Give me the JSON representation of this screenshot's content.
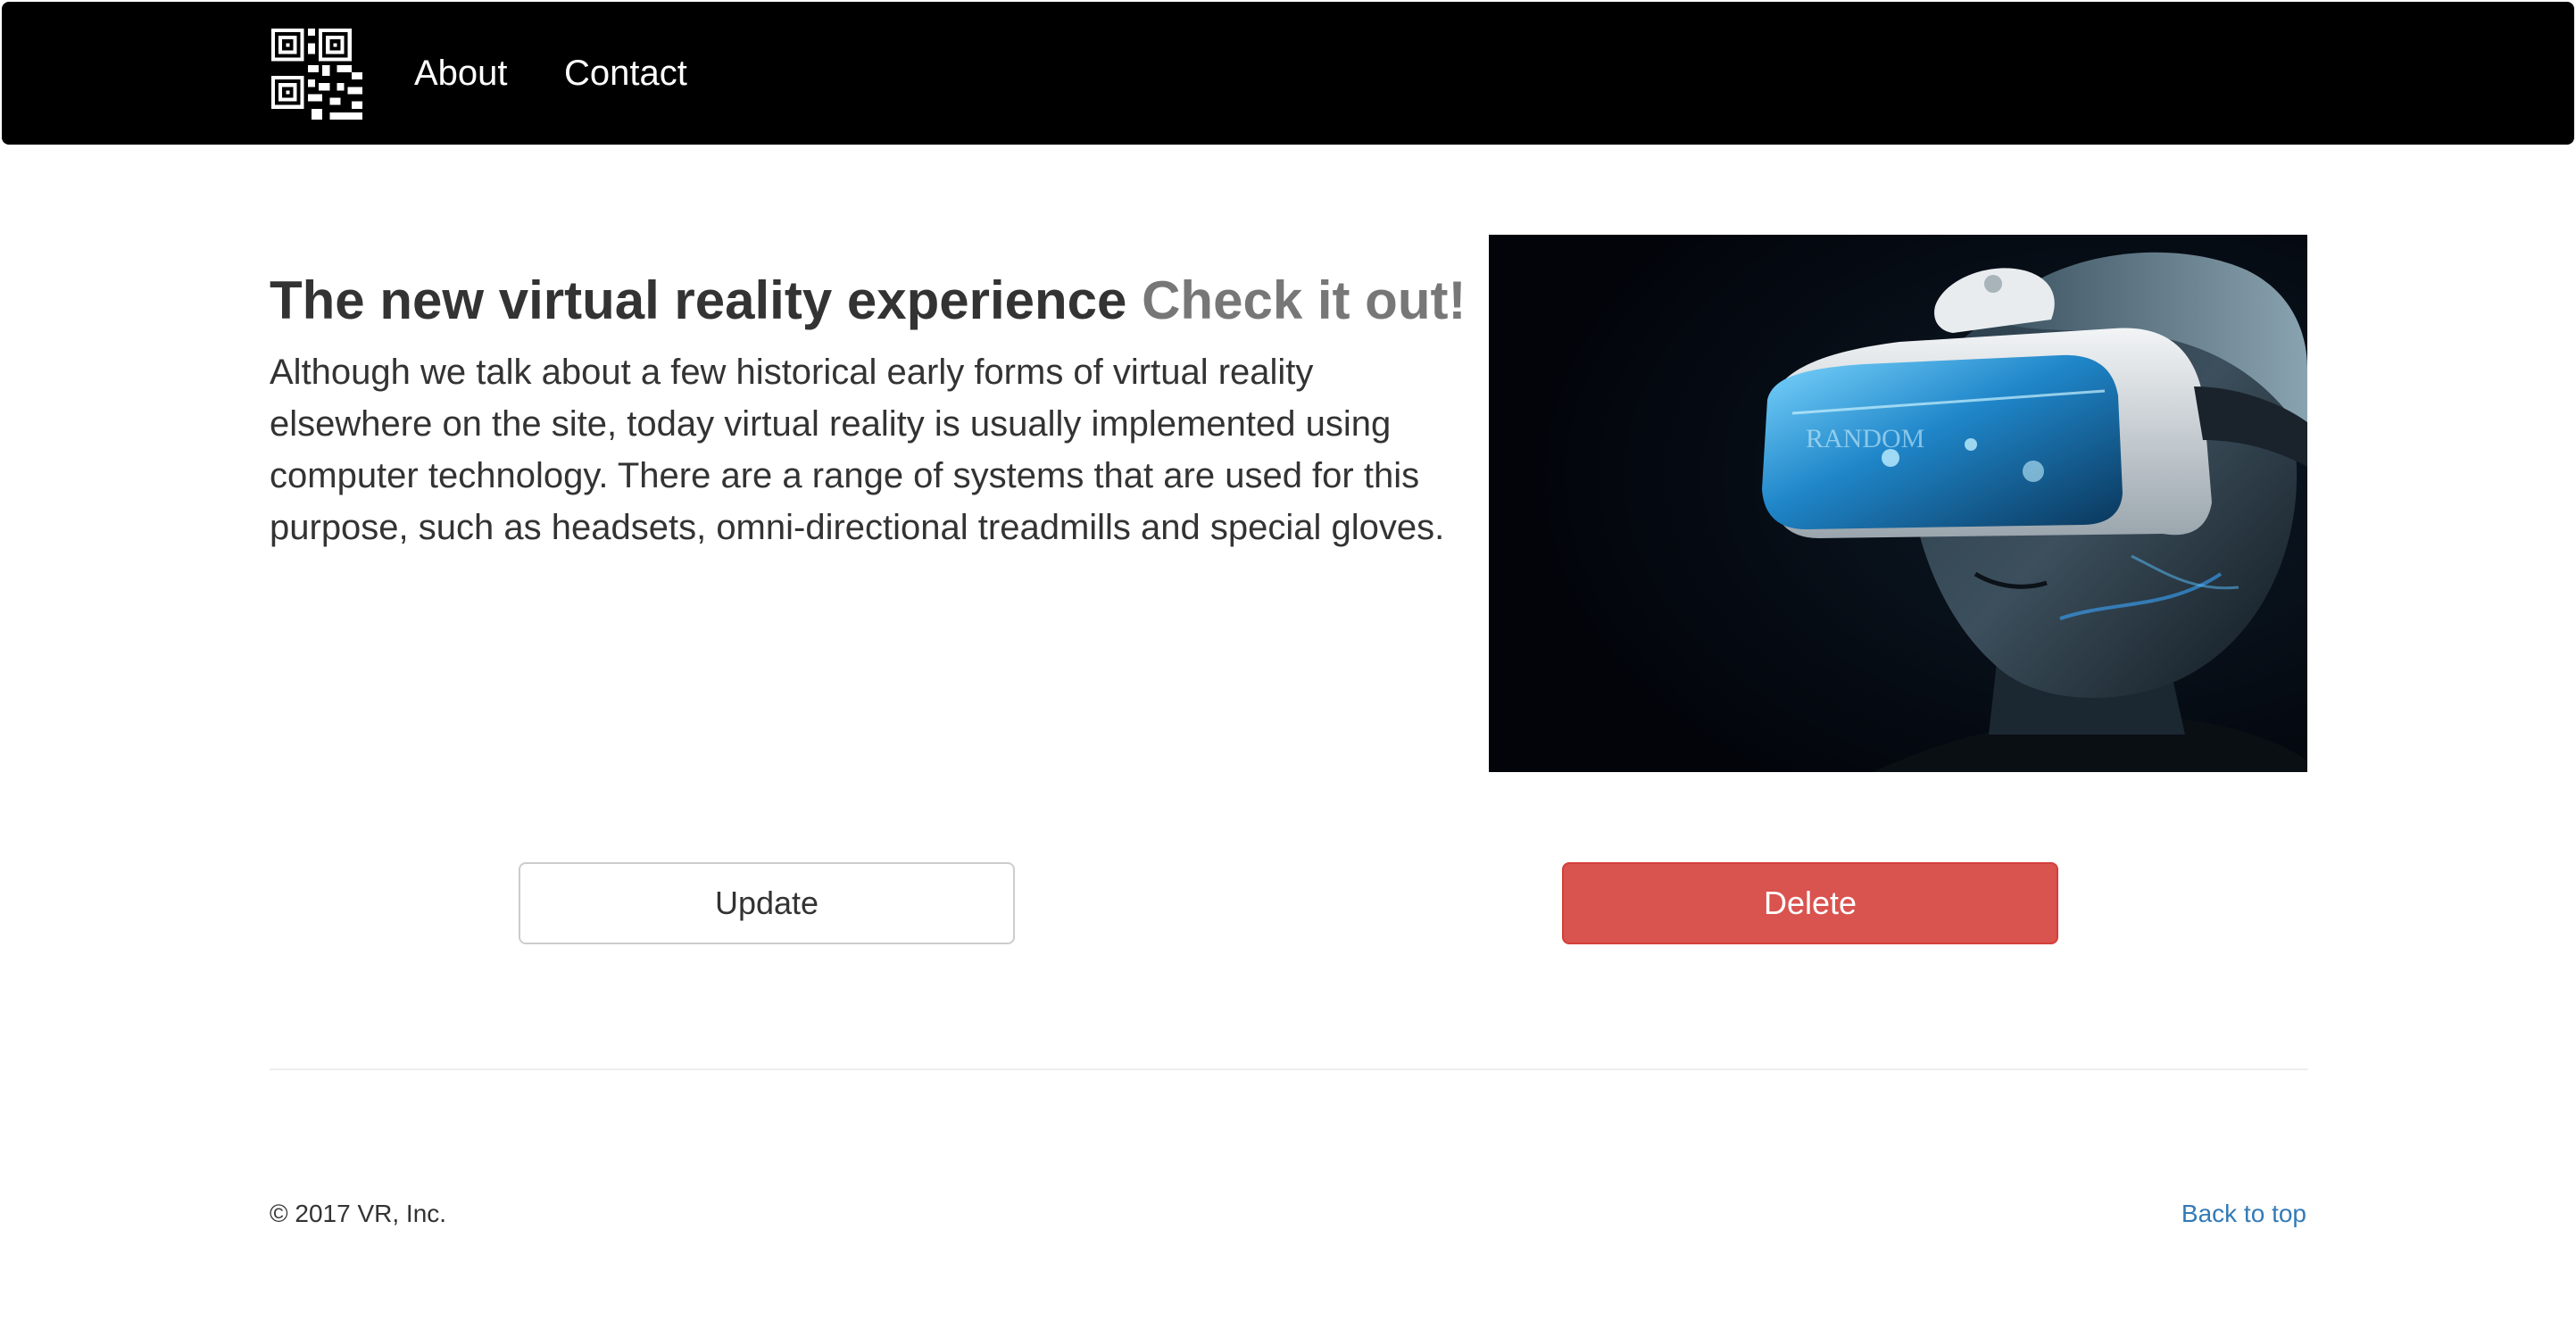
{
  "navbar": {
    "logo_icon": "qr-code-icon",
    "links": [
      {
        "label": "About"
      },
      {
        "label": "Contact"
      }
    ]
  },
  "hero": {
    "heading_main": "The new virtual reality experience",
    "heading_muted": "Check it out!",
    "paragraph": "Although we talk about a few historical early forms of virtual reality elsewhere on the site, today virtual reality is usually implemented using computer technology. There are a range of systems that are used for this purpose, such as headsets, omni-directional treadmills and special gloves.",
    "image_alt": "Person wearing VR headset",
    "headset_brand_text": "RANDOM"
  },
  "actions": {
    "update_label": "Update",
    "delete_label": "Delete"
  },
  "footer": {
    "copyright": "© 2017 VR, Inc.",
    "back_to_top": "Back to top"
  },
  "colors": {
    "navbar_bg": "#000000",
    "delete_bg": "#d9534f",
    "link": "#337ab7",
    "muted_heading": "#777777"
  }
}
